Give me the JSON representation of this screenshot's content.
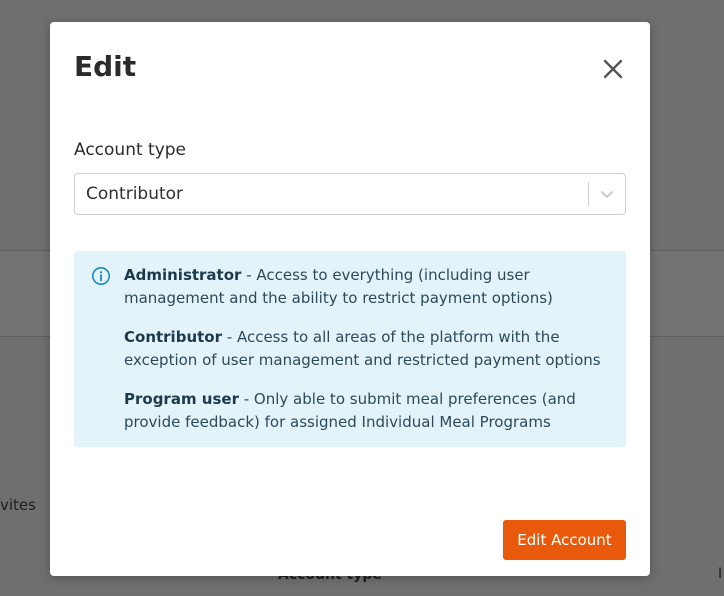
{
  "background": {
    "left_text": "vites",
    "bottom_text": "Account type",
    "right_text": "I"
  },
  "modal": {
    "title": "Edit",
    "close_icon": "close-icon",
    "field_label": "Account type",
    "select": {
      "value": "Contributor",
      "icon": "chevron-down-icon"
    },
    "info": {
      "icon": "info-icon",
      "items": [
        {
          "role": "Administrator",
          "description": " - Access to everything (including user management and the ability to restrict payment options)"
        },
        {
          "role": "Contributor",
          "description": " - Access to all areas of the platform with the exception of user management and restricted payment options"
        },
        {
          "role": "Program user",
          "description": " - Only able to submit meal preferences (and provide feedback) for assigned Individual Meal Programs"
        }
      ]
    },
    "primary_button": "Edit Account"
  },
  "colors": {
    "accent": "#e8590c",
    "info_bg": "#e3f3fa",
    "info_icon": "#1a8ac4",
    "overlay": "#6f6f6f"
  }
}
